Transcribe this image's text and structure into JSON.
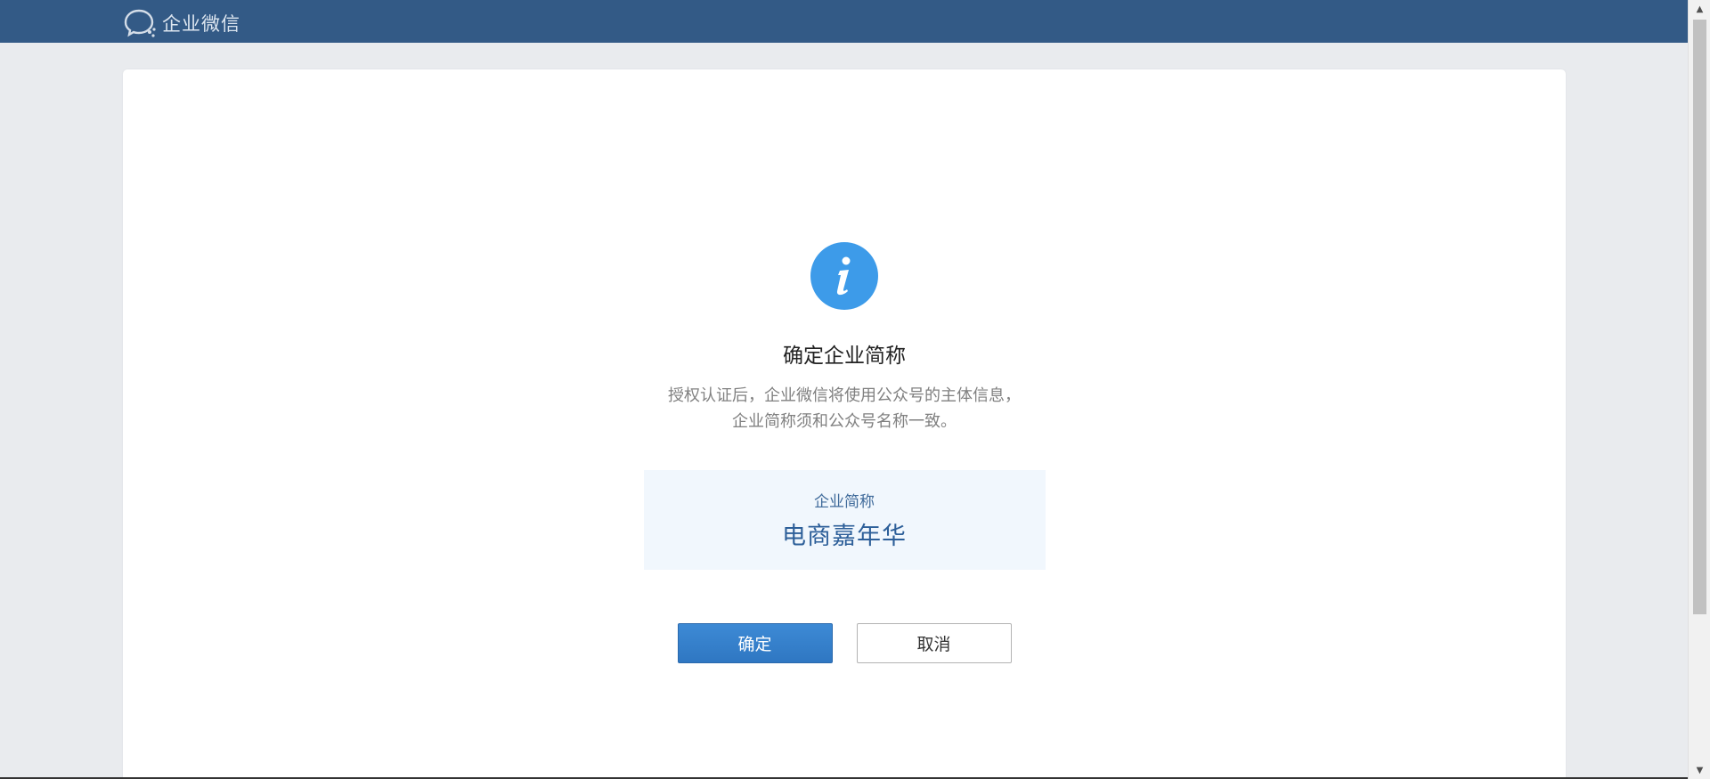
{
  "header": {
    "brand_name": "企业微信",
    "logo_icon": "wework-chat-bubble-icon",
    "bg_color": "#335a86"
  },
  "dialog": {
    "status_icon": "info-icon",
    "icon_color": "#3d9be9",
    "title": "确定企业简称",
    "description_line1": "授权认证后，企业微信将使用公众号的主体信息，",
    "description_line2": "企业简称须和公众号名称一致。",
    "name_label": "企业简称",
    "name_value": "电商嘉年华"
  },
  "actions": {
    "confirm_label": "确定",
    "cancel_label": "取消",
    "primary_color": "#3382cc"
  },
  "scrollbar": {
    "up_icon": "scroll-up-arrow-icon",
    "down_icon": "scroll-down-arrow-icon"
  }
}
